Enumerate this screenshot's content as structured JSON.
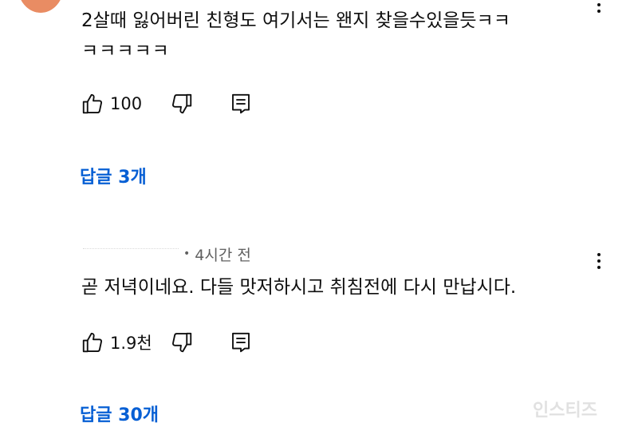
{
  "comments": [
    {
      "text_line1": "2살때 잃어버린 친형도 여기서는 왠지 찾을수있을듯ㅋㅋ",
      "text_line2": "ㅋㅋㅋㅋㅋ",
      "likes": "100",
      "replies": "답글 3개"
    },
    {
      "time": "4시간 전",
      "text": "곧 저녁이네요. 다들 맛저하시고 취침전에 다시 만납시다.",
      "likes": "1.9천",
      "replies": "답글 30개"
    }
  ],
  "colors": {
    "link": "#065fd4",
    "text": "#0f0f0f",
    "meta": "#606060",
    "avatar": "#f1a27c"
  },
  "icons": [
    "thumbs-up-icon",
    "thumbs-down-icon",
    "reply-icon",
    "more-vert-icon"
  ],
  "watermark": "인스티즈"
}
